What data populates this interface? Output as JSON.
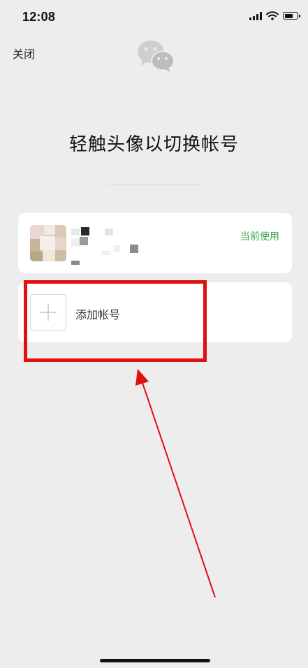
{
  "status_bar": {
    "time": "12:08",
    "battery_level": 0.7
  },
  "header": {
    "close_label": "关闭",
    "logo_icon": "wechat-logo-icon"
  },
  "title": "轻触头像以切换帐号",
  "accounts": [
    {
      "status_label": "当前使用"
    }
  ],
  "add_account": {
    "label": "添加帐号",
    "icon": "plus-icon"
  },
  "colors": {
    "background": "#ededed",
    "card": "#ffffff",
    "accent_green": "#3aa64f",
    "annotation_red": "#e01010"
  }
}
